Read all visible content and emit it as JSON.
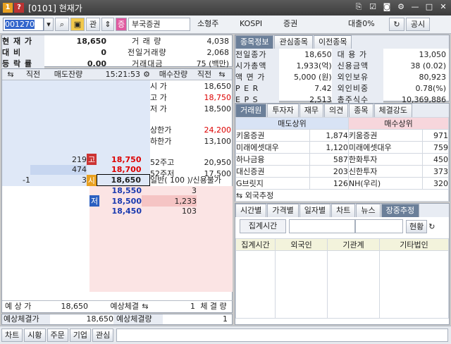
{
  "window": {
    "num": "1",
    "title": "[0101] 현재가"
  },
  "toolbar": {
    "code": "001270",
    "btn_gwan": "관",
    "name": "부국증권",
    "sector": "소형주",
    "market": "KOSPI",
    "industry": "증권",
    "loan": "대출0%",
    "notice": "공시"
  },
  "summary": {
    "price_label": "현 재 가",
    "price": "18,650",
    "diff_label": "대   비",
    "diff": "0",
    "rate_label": "등 락 률",
    "rate": "0.00",
    "vol_label": "거 래 량",
    "vol": "4,038",
    "prevvol_label": "전일거래량",
    "prevvol": "2,068",
    "amt_label": "거래대금",
    "amt": "75 (백만)"
  },
  "info_tabs": [
    "종목정보",
    "관심종목",
    "이전종목"
  ],
  "info_left": [
    [
      "전일종가",
      "18,650"
    ],
    [
      "시가총액",
      "1,933(억)"
    ],
    [
      "액 면 가",
      "5,000 (원)"
    ],
    [
      "P E R",
      "7.42"
    ],
    [
      "E P S",
      "2,513"
    ]
  ],
  "info_right": [
    [
      "대 용 가",
      "13,050"
    ],
    [
      "신용금액",
      "38  (0.02)"
    ],
    [
      "외인보유",
      "80,923"
    ],
    [
      "외인비중",
      "0.78(%)"
    ],
    [
      "총주식수",
      "10,369,886"
    ]
  ],
  "ob": {
    "h_prev": "직전",
    "h_sell": "매도잔량",
    "time": "15:21:53",
    "h_buy": "매수잔량",
    "h_prev2": "직전",
    "sell": [
      {
        "vol": "219",
        "tag": "고",
        "price": "18,750"
      },
      {
        "vol": "474",
        "tag": "",
        "price": "18,700"
      },
      {
        "prev": "-1",
        "vol": "3",
        "tag": "시",
        "price": "18,650"
      }
    ],
    "buy": [
      {
        "price": "18,550",
        "vol": "3"
      },
      {
        "tag": "저",
        "price": "18,500",
        "vol": "1,233"
      },
      {
        "price": "18,450",
        "vol": "103"
      }
    ],
    "stats": [
      [
        "시  가",
        "18,650"
      ],
      [
        "고  가",
        "18,750"
      ],
      [
        "저  가",
        "18,500"
      ],
      [
        "",
        ""
      ],
      [
        "상한가",
        "24,200"
      ],
      [
        "하한가",
        "13,100"
      ],
      [
        "",
        ""
      ],
      [
        "52주고",
        "20,950"
      ],
      [
        "52주저",
        "17,500"
      ]
    ],
    "unit": "일반( 100 )/신용불가",
    "foot": {
      "exp_label": "예 상 가",
      "exp": "18,650",
      "fill_label": "예상체결",
      "fill": "1",
      "fill2": "체 결 량"
    }
  },
  "bottom": {
    "price_label": "예상체결가",
    "price": "18,650",
    "qty_label": "예상체결량",
    "qty": "1"
  },
  "broker": {
    "tabs": [
      "거래원",
      "투자자",
      "재무",
      "의견",
      "종목",
      "체결강도"
    ],
    "sell_h": "매도상위",
    "buy_h": "매수상위",
    "rows": [
      [
        "키움증권",
        "1,874",
        "키움증권",
        "971"
      ],
      [
        "미래에셋대우",
        "1,120",
        "미래에셋대우",
        "759"
      ],
      [
        "하나금융",
        "587",
        "한화투자",
        "450"
      ],
      [
        "대신증권",
        "203",
        "신한투자",
        "373"
      ],
      [
        "G브릿지",
        "126",
        "NH(우리)",
        "320"
      ]
    ],
    "foreign": "외국추정"
  },
  "invest": {
    "tabs": [
      "시간별",
      "가격별",
      "일자별",
      "차트",
      "뉴스",
      "장중추정"
    ],
    "time_label": "집계시간",
    "btn": "현황",
    "cols": [
      "집계시간",
      "외국인",
      "기관계",
      "기타법인"
    ]
  },
  "status": [
    "차트",
    "시황",
    "주문",
    "기업",
    "관심"
  ]
}
